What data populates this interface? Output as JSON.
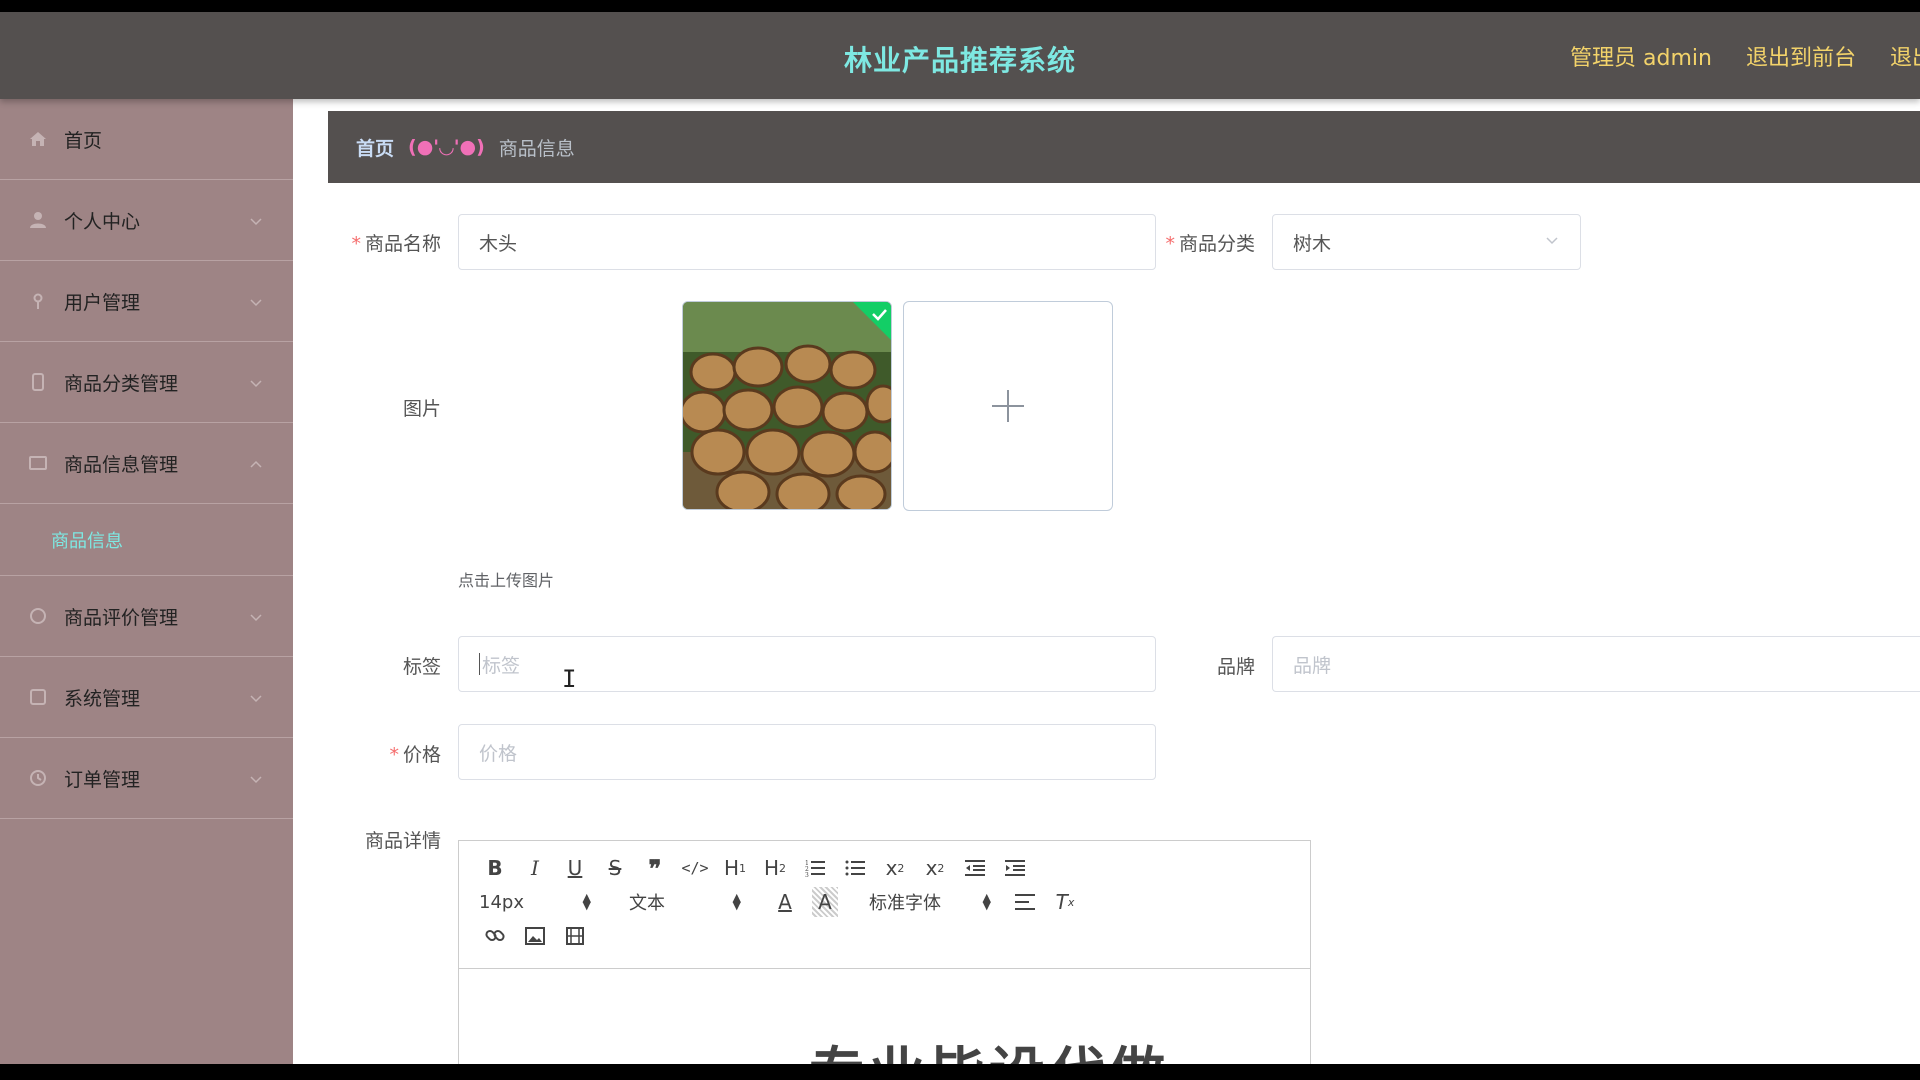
{
  "header": {
    "title": "林业产品推荐系统",
    "admin_label": "管理员 admin",
    "back_frontend": "退出到前台",
    "logout_partial": "退出"
  },
  "sidebar": {
    "items": [
      {
        "label": "首页",
        "icon": "home-icon"
      },
      {
        "label": "个人中心",
        "icon": "user-icon"
      },
      {
        "label": "用户管理",
        "icon": "users-icon"
      },
      {
        "label": "商品分类管理",
        "icon": "category-icon"
      },
      {
        "label": "商品信息管理",
        "icon": "product-icon"
      },
      {
        "label": "商品评价管理",
        "icon": "comment-icon"
      },
      {
        "label": "系统管理",
        "icon": "system-icon"
      },
      {
        "label": "订单管理",
        "icon": "order-icon"
      }
    ],
    "submenu_active": "商品信息"
  },
  "breadcrumb": {
    "home": "首页",
    "separator": "(●'◡'●)",
    "current": "商品信息"
  },
  "form": {
    "name_label": "商品名称",
    "name_value": "木头",
    "category_label": "商品分类",
    "category_value": "树木",
    "image_label": "图片",
    "upload_tip": "点击上传图片",
    "tag_label": "标签",
    "tag_placeholder": "标签",
    "brand_label": "品牌",
    "brand_placeholder": "品牌",
    "price_label": "价格",
    "price_placeholder": "价格",
    "detail_label": "商品详情"
  },
  "editor": {
    "font_size": "14px",
    "block_type": "文本",
    "font_family": "标准字体",
    "content_text": "专业毕设代做"
  },
  "colors": {
    "accent": "#7ee8e2",
    "header_bg": "#54504f",
    "sidebar_bg": "#9e8485",
    "top_link": "#f3d36a",
    "required": "#f56c6c"
  }
}
